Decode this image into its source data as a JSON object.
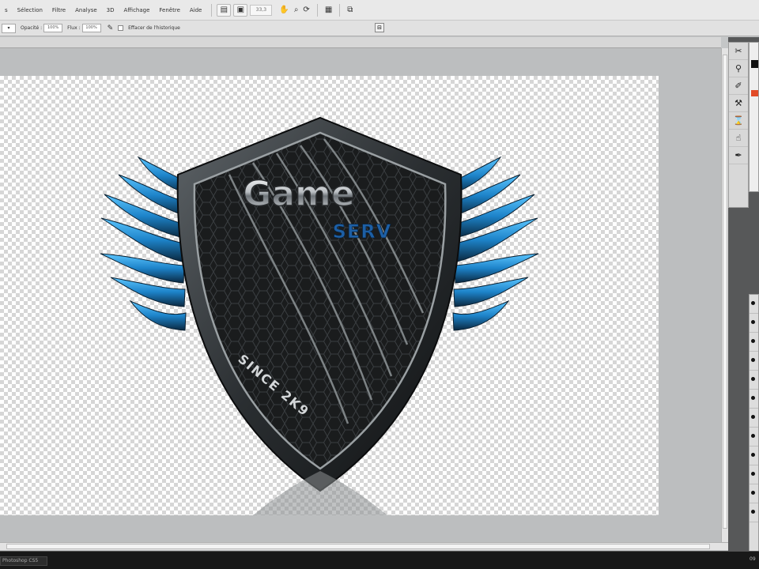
{
  "menubar": {
    "items": [
      "s",
      "Sélection",
      "Filtre",
      "Analyse",
      "3D",
      "Affichage",
      "Fenêtre",
      "Aide"
    ],
    "zoom_label": "33,3",
    "toolbar_icons": [
      "layout-icon",
      "screen-mode-icon",
      "hand-icon",
      "zoom-icon",
      "rotate-icon",
      "arrange-icon",
      "view-extras-icon"
    ]
  },
  "optionsbar": {
    "tool_preset": "▾",
    "opacity_label": "Opacité :",
    "opacity_value": "100%",
    "flow_label": "Flux :",
    "flow_value": "100%",
    "airbrush_label": "Effacer de l'historique"
  },
  "artwork": {
    "title_text": "Game",
    "subtitle_text": "SERV",
    "since_text": "SINCE 2K9",
    "colors": {
      "shield_dark": "#1d1f20",
      "shield_rim": "#8d9396",
      "wing_blue": "#1f8fd8",
      "wing_dark": "#0c2e4a",
      "title_silver": "#d9dcde",
      "subtitle_blue": "#1d5fa5"
    }
  },
  "right_dock": {
    "tools": [
      "scissors-icon",
      "stamp-icon",
      "brush-settings-icon",
      "tool-presets-icon",
      "history-icon",
      "smudge-icon",
      "pen-icon"
    ],
    "foreground_color": "#111111",
    "background_color": "#e24a26"
  },
  "taskbar": {
    "app_label": "Photoshop CS5",
    "clock": "09"
  }
}
